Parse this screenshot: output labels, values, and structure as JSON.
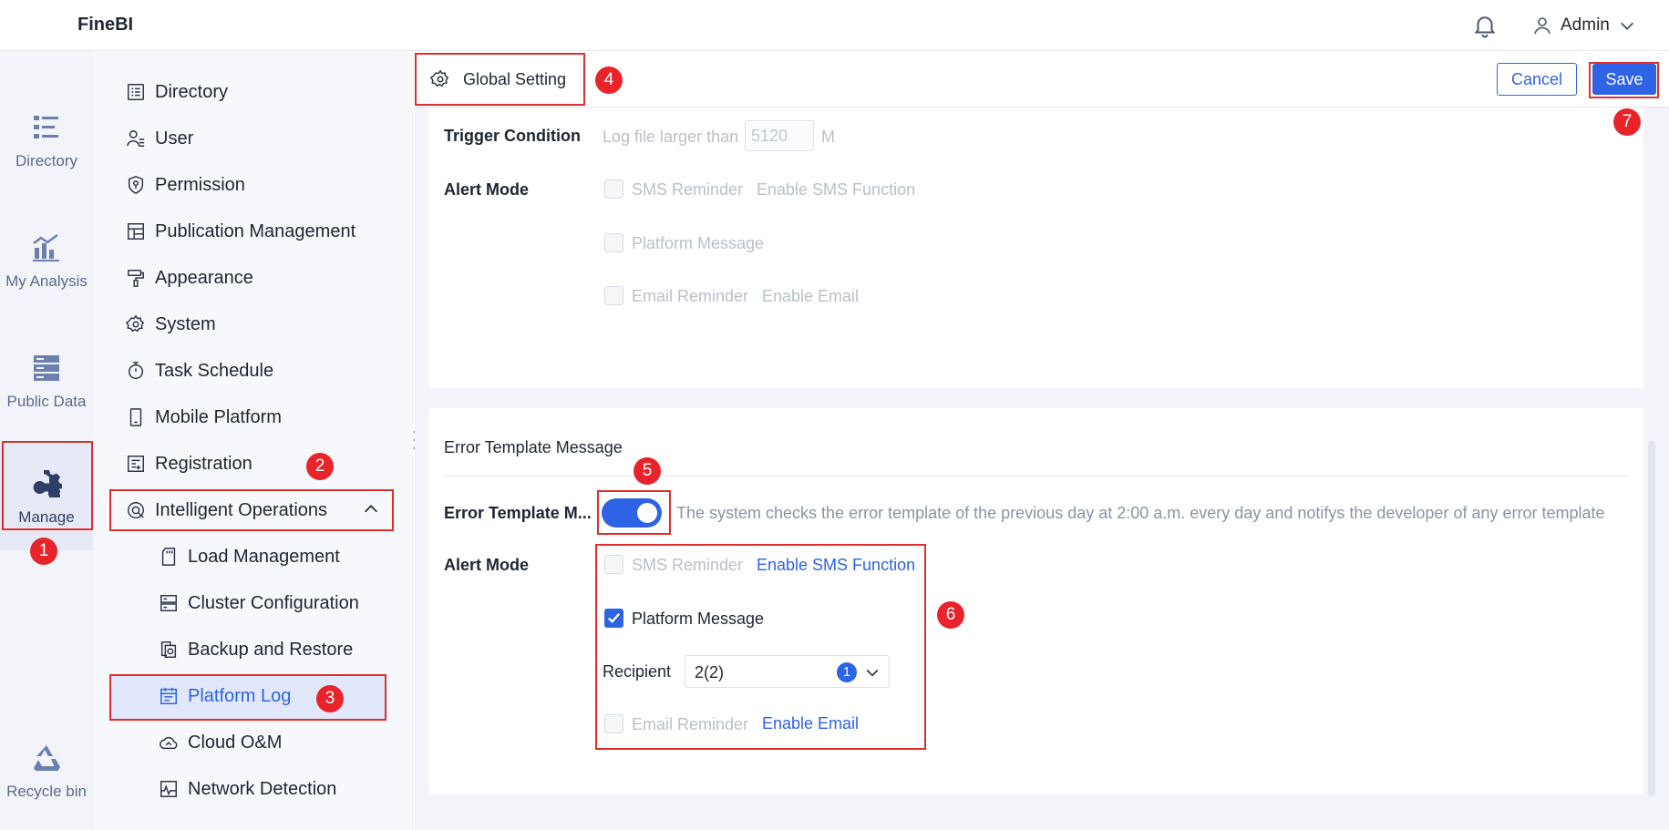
{
  "app": {
    "name": "FineBI"
  },
  "header": {
    "user_name": "Admin"
  },
  "rail": {
    "items": [
      {
        "label": "Directory",
        "icon": "directory-icon"
      },
      {
        "label": "My Analysis",
        "icon": "analysis-icon"
      },
      {
        "label": "Public Data",
        "icon": "public-data-icon"
      },
      {
        "label": "Manage",
        "icon": "manage-icon",
        "active": true
      },
      {
        "label": "Recycle bin",
        "icon": "recycle-bin-icon"
      }
    ]
  },
  "sidebar": {
    "items": [
      {
        "label": "Directory"
      },
      {
        "label": "User"
      },
      {
        "label": "Permission"
      },
      {
        "label": "Publication Management"
      },
      {
        "label": "Appearance"
      },
      {
        "label": "System"
      },
      {
        "label": "Task Schedule"
      },
      {
        "label": "Mobile Platform"
      },
      {
        "label": "Registration"
      },
      {
        "label": "Intelligent Operations",
        "expanded": true
      }
    ],
    "sub_items": [
      {
        "label": "Load Management"
      },
      {
        "label": "Cluster Configuration"
      },
      {
        "label": "Backup and Restore"
      },
      {
        "label": "Platform Log",
        "active": true
      },
      {
        "label": "Cloud O&M"
      },
      {
        "label": "Network Detection"
      }
    ]
  },
  "toolbar": {
    "title": "Global Setting",
    "cancel_label": "Cancel",
    "save_label": "Save"
  },
  "log_alert": {
    "trigger_label": "Trigger Condition",
    "trigger_prefix": "Log file larger than",
    "trigger_value": "5120",
    "trigger_unit": "M",
    "alert_mode_label": "Alert Mode",
    "sms_label": "SMS Reminder",
    "sms_link": "Enable SMS Function",
    "platform_label": "Platform Message",
    "email_label": "Email Reminder",
    "email_link": "Enable Email"
  },
  "error_template": {
    "section_title": "Error Template Message",
    "toggle_label": "Error Template M...",
    "toggle_on": true,
    "description": "The system checks the error template of the previous day at 2:00 a.m. every day and notifys the developer of any error template",
    "alert_mode_label": "Alert Mode",
    "sms_label": "SMS Reminder",
    "sms_link": "Enable SMS Function",
    "platform_label": "Platform Message",
    "platform_checked": true,
    "recipient_label": "Recipient",
    "recipient_value": "2(2)",
    "recipient_badge": "1",
    "email_label": "Email Reminder",
    "email_link": "Enable Email"
  },
  "markers": [
    "1",
    "2",
    "3",
    "4",
    "5",
    "6",
    "7"
  ],
  "colors": {
    "accent": "#2e63e6",
    "annotation": "#e02e2e"
  }
}
